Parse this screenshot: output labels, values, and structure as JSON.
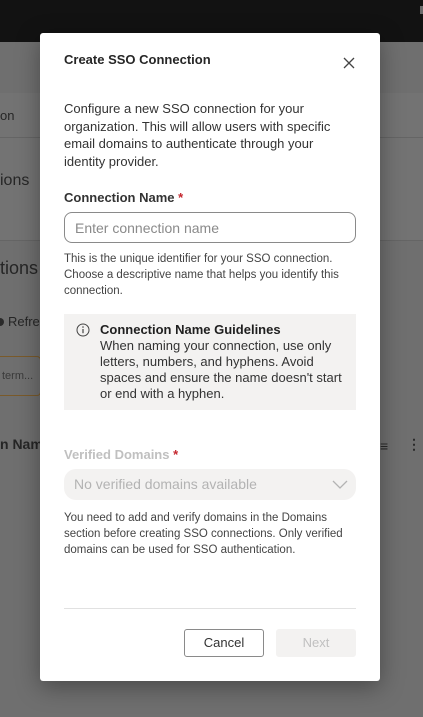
{
  "background": {
    "nav_fragment": "on",
    "section_fragment": "ions",
    "heading_fragment": "tions",
    "refresh_fragment": "Refre",
    "search_fragment": "term...",
    "column_fragment": "n Nam"
  },
  "modal": {
    "title": "Create SSO Connection",
    "intro": "Configure a new SSO connection for your organization. This will allow users with specific email domains to authenticate through your identity provider.",
    "connection_name": {
      "label": "Connection Name",
      "required_mark": "*",
      "placeholder": "Enter connection name",
      "value": "",
      "help": "This is the unique identifier for your SSO connection. Choose a descriptive name that helps you identify this connection."
    },
    "guidelines": {
      "title": "Connection Name Guidelines",
      "body": "When naming your connection, use only letters, numbers, and hyphens. Avoid spaces and ensure the name doesn't start or end with a hyphen."
    },
    "verified_domains": {
      "label": "Verified Domains",
      "required_mark": "*",
      "selected": "No verified domains available",
      "help": "You need to add and verify domains in the Domains section before creating SSO connections. Only verified domains can be used for SSO authentication."
    },
    "buttons": {
      "cancel": "Cancel",
      "next": "Next"
    }
  },
  "colors": {
    "required": "#c4262e",
    "overlay": "#6f6f6f",
    "topbar": "#121212",
    "panel": "#f3f2f1"
  },
  "icons": [
    "close-icon",
    "info-icon",
    "chevron-down-icon",
    "filter-icon",
    "more-icon"
  ]
}
